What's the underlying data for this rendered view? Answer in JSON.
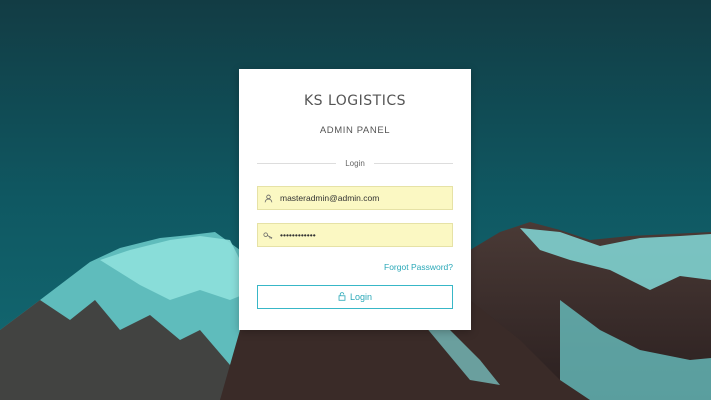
{
  "brand": "KS LOGISTICS",
  "subtitle": "ADMIN PANEL",
  "divider_label": "Login",
  "email": {
    "value": "masteradmin@admin.com",
    "icon": "user-icon"
  },
  "password": {
    "value": "••••••••••••",
    "icon": "key-icon"
  },
  "forgot_label": "Forgot Password?",
  "login_button": {
    "label": "Login",
    "icon": "lock-icon"
  },
  "colors": {
    "accent": "#1ec6c6",
    "link": "#2aa8b8",
    "field_bg": "#fbf8c3",
    "sky": "#0f4a52"
  }
}
